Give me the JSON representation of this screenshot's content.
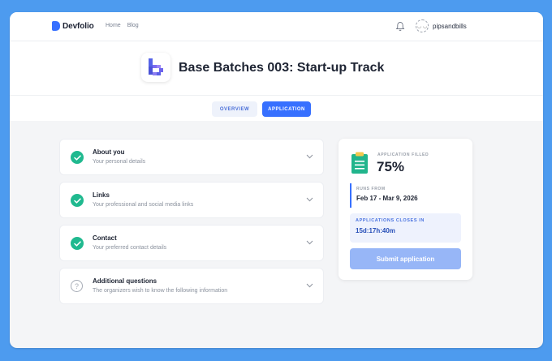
{
  "header": {
    "brand": "Devfolio",
    "nav": [
      "Home",
      "Blog"
    ],
    "avatar_glyph": "◡ ◡",
    "username": "pipsandbills"
  },
  "hero": {
    "title": "Base Batches 003: Start-up Track"
  },
  "tabs": [
    {
      "label": "OVERVIEW",
      "active": false
    },
    {
      "label": "APPLICATION",
      "active": true
    }
  ],
  "sections": [
    {
      "title": "About you",
      "subtitle": "Your personal details",
      "status": "complete"
    },
    {
      "title": "Links",
      "subtitle": "Your professional and social media links",
      "status": "complete"
    },
    {
      "title": "Contact",
      "subtitle": "Your preferred contact details",
      "status": "complete"
    },
    {
      "title": "Additional questions",
      "subtitle": "The organizers wish to know the following information",
      "status": "pending"
    }
  ],
  "status_card": {
    "filled_label": "APPLICATION FILLED",
    "filled_value": "75%",
    "runs_label": "RUNS FROM",
    "runs_value": "Feb 17 - Mar 9, 2026",
    "closes_label": "APPLICATIONS CLOSES IN",
    "closes_value": "15d:17h:40m",
    "submit_label": "Submit application"
  },
  "colors": {
    "frame": "#4d9bef",
    "accent": "#3770ff",
    "success": "#20b98f",
    "clipboard": "#21b58c"
  },
  "icons": [
    "devfolio-logo-icon",
    "bell-icon",
    "avatar-icon",
    "base-batches-logo-icon",
    "check-circle-icon",
    "question-circle-icon",
    "chevron-down-icon",
    "clipboard-icon"
  ]
}
